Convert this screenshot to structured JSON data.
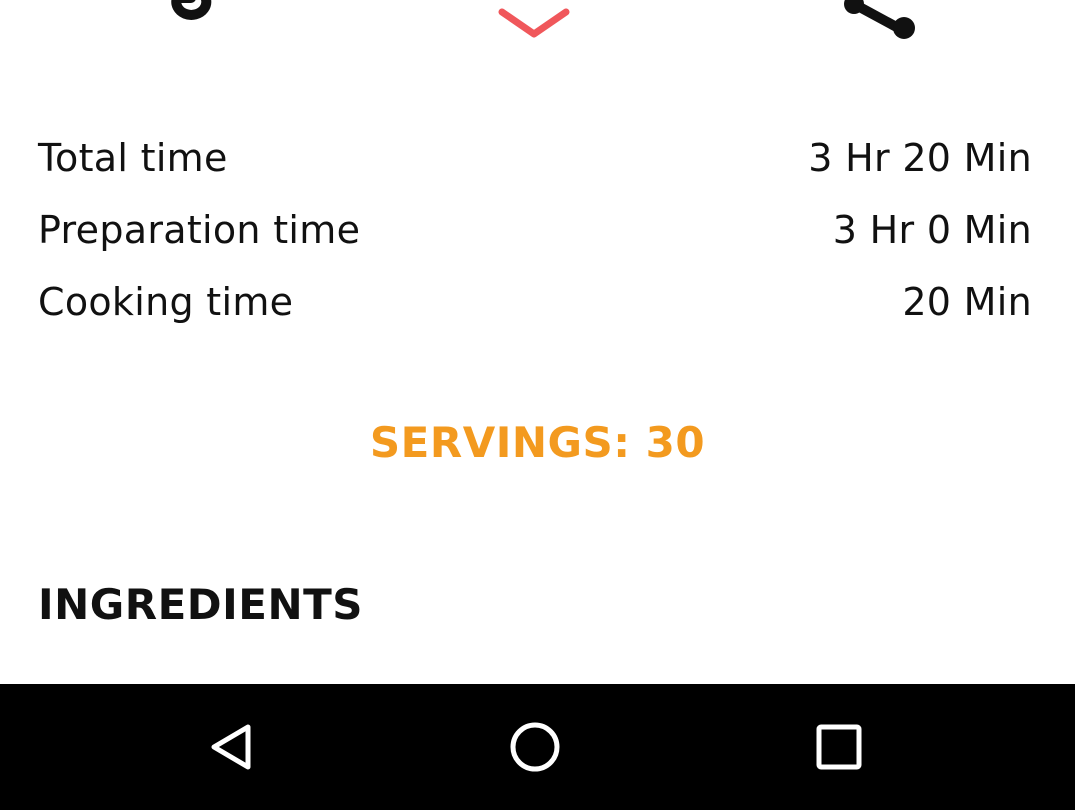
{
  "actions": {
    "icons": {
      "timer": "timer-icon",
      "favorite": "heart-icon",
      "share": "share-icon"
    },
    "favorite_color": "#F0575B"
  },
  "times": [
    {
      "label": "Total time",
      "value": "3 Hr 20 Min"
    },
    {
      "label": "Preparation time",
      "value": "3 Hr 0 Min"
    },
    {
      "label": "Cooking time",
      "value": "20 Min"
    }
  ],
  "servings": {
    "text": "SERVINGS: 30",
    "color": "#F39A1F"
  },
  "ingredients": {
    "heading": "INGREDIENTS"
  },
  "navigation": {
    "icons": {
      "back": "back-triangle-icon",
      "home": "home-circle-icon",
      "recents": "recents-square-icon"
    },
    "background": "#000000",
    "icon_color": "#FFFFFF"
  }
}
